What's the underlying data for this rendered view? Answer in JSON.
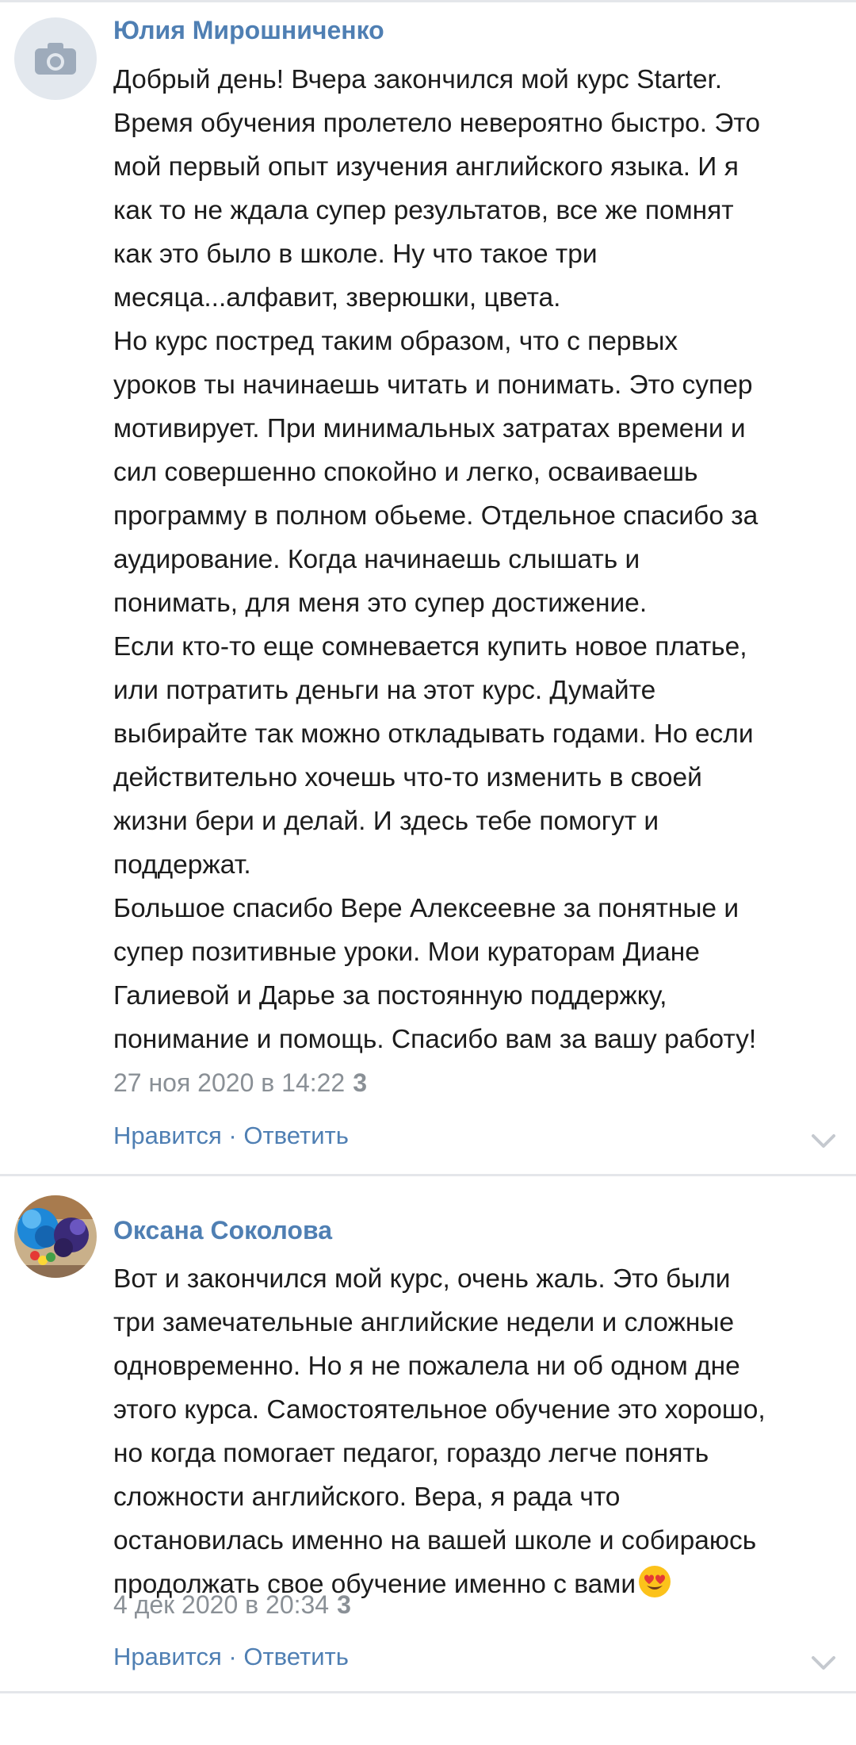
{
  "comments": [
    {
      "author": "Юлия Мирошниченко",
      "avatar": "camera-placeholder",
      "paragraphs": [
        "Добрый день! Вчера закончился мой курс Starter.\nВремя обучения пролетело невероятно быстро. Это\nмой первый опыт изучения английского языка. И я\nкак то не ждала супер результатов, все же помнят\nкак это было в школе. Ну что такое три\nмесяца...алфавит, зверюшки, цвета.\nНо курс постред таким образом, что с первых\nуроков ты начинаешь читать и понимать. Это супер\nмотивирует. При минимальных затратах времени и\nсил совершенно спокойно и легко, осваиваешь\nпрограмму в полном обьеме. Отдельное спасибо за\nаудирование. Когда начинаешь слышать и\nпонимать, для меня это супер достижение.\nЕсли кто-то еще сомневается купить новое платье,\nили потратить деньги на этот курс. Думайте\nвыбирайте так можно откладывать годами. Но если\nдействительно хочешь что-то изменить в своей\nжизни бери и делай. И здесь тебе помогут и\nподдержат.\nБольшое спасибо Вере Алексеевне за понятные и\nсупер позитивные уроки. Мои кураторам Диане\nГалиевой и Дарье за постоянную поддержку,\nпонимание и помощь. Спасибо вам за вашу работу!"
      ],
      "date": "27 ноя 2020 в 14:22",
      "likes": "3",
      "like_label": "Нравится",
      "separator": " · ",
      "reply_label": "Ответить"
    },
    {
      "author": "Оксана Соколова",
      "avatar": "flowers-photo",
      "paragraphs": [
        "Вот и закончился мой курс, очень жаль. Это были\nтри замечательные английские недели и сложные\nодновременно. Но я не пожалела ни об одном дне\nэтого курса. Самостоятельное обучение это хорошо,\nно когда помогает педагог, гораздо легче понять\nсложности английского. Вера, я рада что\nостановилась именно на вашей школе и собираюсь\nпродолжать свое обучение именно с вами"
      ],
      "emoji": "heart-eyes-emoji",
      "date": "4 дек 2020 в 20:34",
      "likes": "3",
      "like_label": "Нравится",
      "separator": " · ",
      "reply_label": "Ответить"
    }
  ],
  "colors": {
    "link": "#4f7fb3",
    "text": "#1c1c1c",
    "meta": "#8a9096",
    "divider": "#e4e6ea"
  }
}
